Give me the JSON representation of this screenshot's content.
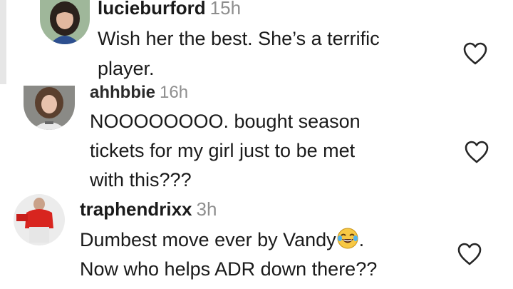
{
  "comments": [
    {
      "username": "lucieburford",
      "time": "15h",
      "lines": [
        "Wish her the best. She’s a terrific",
        "player."
      ],
      "avatar_icon": "profile-photo-woman-dark-hair",
      "like_icon": "heart-outline-icon"
    },
    {
      "username": "ahhbbie",
      "time": "16h",
      "lines": [
        "NOOOOOOOO. bought season",
        "tickets for my girl just to be met",
        "with this???"
      ],
      "avatar_icon": "profile-photo-young-woman",
      "like_icon": "heart-outline-icon"
    },
    {
      "username": "traphendrixx",
      "time": "3h",
      "lines": [
        "Dumbest move ever by Vandy",
        ".",
        "Now who helps ADR down there??"
      ],
      "emoji": "face-with-tears-of-joy",
      "avatar_icon": "profile-photo-man-red-shirt",
      "like_icon": "heart-outline-icon"
    }
  ],
  "colors": {
    "text": "#1a1a1a",
    "timestamp": "#8e8e8e",
    "background": "#ffffff",
    "heart_stroke": "#262626"
  }
}
